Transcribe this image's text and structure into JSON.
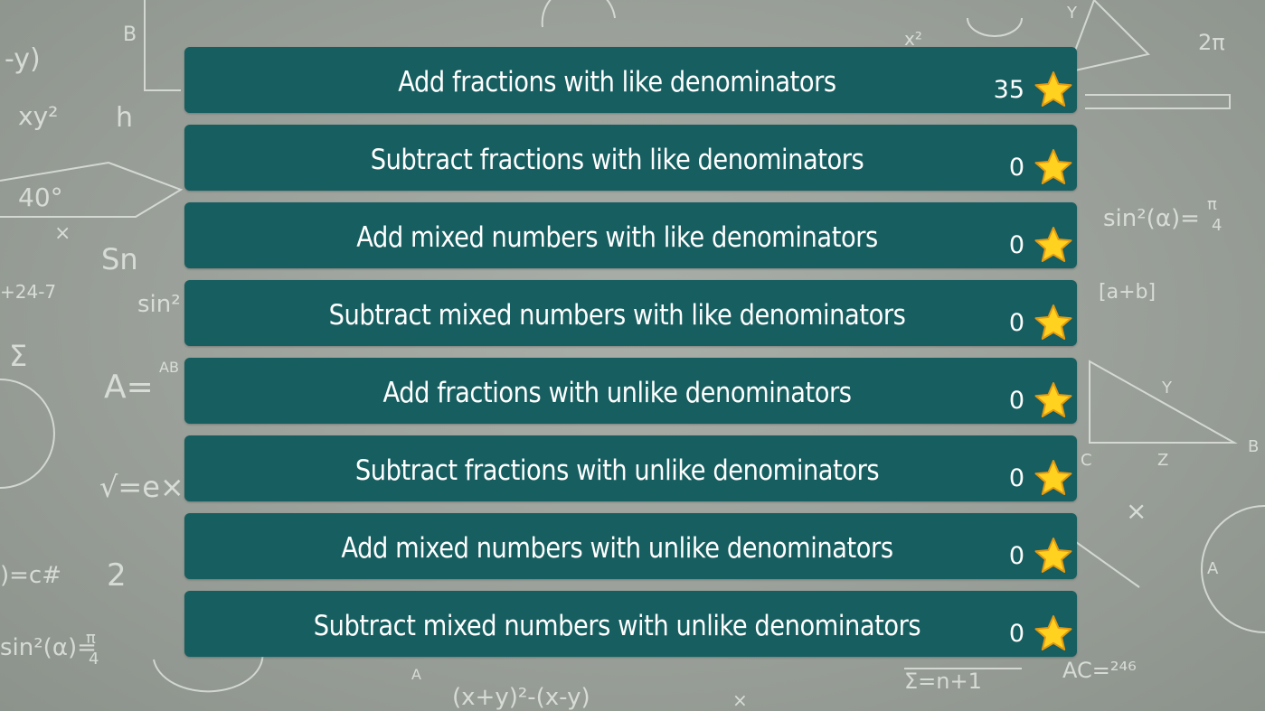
{
  "theme": {
    "row_color": "#165e60",
    "text_color": "#ffffff",
    "star_color": "#ffd21f",
    "background": "#9fa59e"
  },
  "lessons": [
    {
      "title": "Add fractions with like denominators",
      "stars": "35",
      "icon": "star-icon"
    },
    {
      "title": "Subtract fractions with like denominators",
      "stars": "0",
      "icon": "star-icon"
    },
    {
      "title": "Add mixed numbers with like denominators",
      "stars": "0",
      "icon": "star-icon"
    },
    {
      "title": "Subtract mixed numbers with like denominators",
      "stars": "0",
      "icon": "star-icon"
    },
    {
      "title": "Add fractions with unlike denominators",
      "stars": "0",
      "icon": "star-icon"
    },
    {
      "title": "Subtract fractions with unlike denominators",
      "stars": "0",
      "icon": "star-icon"
    },
    {
      "title": "Add mixed numbers with unlike denominators",
      "stars": "0",
      "icon": "star-icon"
    },
    {
      "title": "Subtract mixed numbers with unlike denominators",
      "stars": "0",
      "icon": "star-icon"
    }
  ]
}
